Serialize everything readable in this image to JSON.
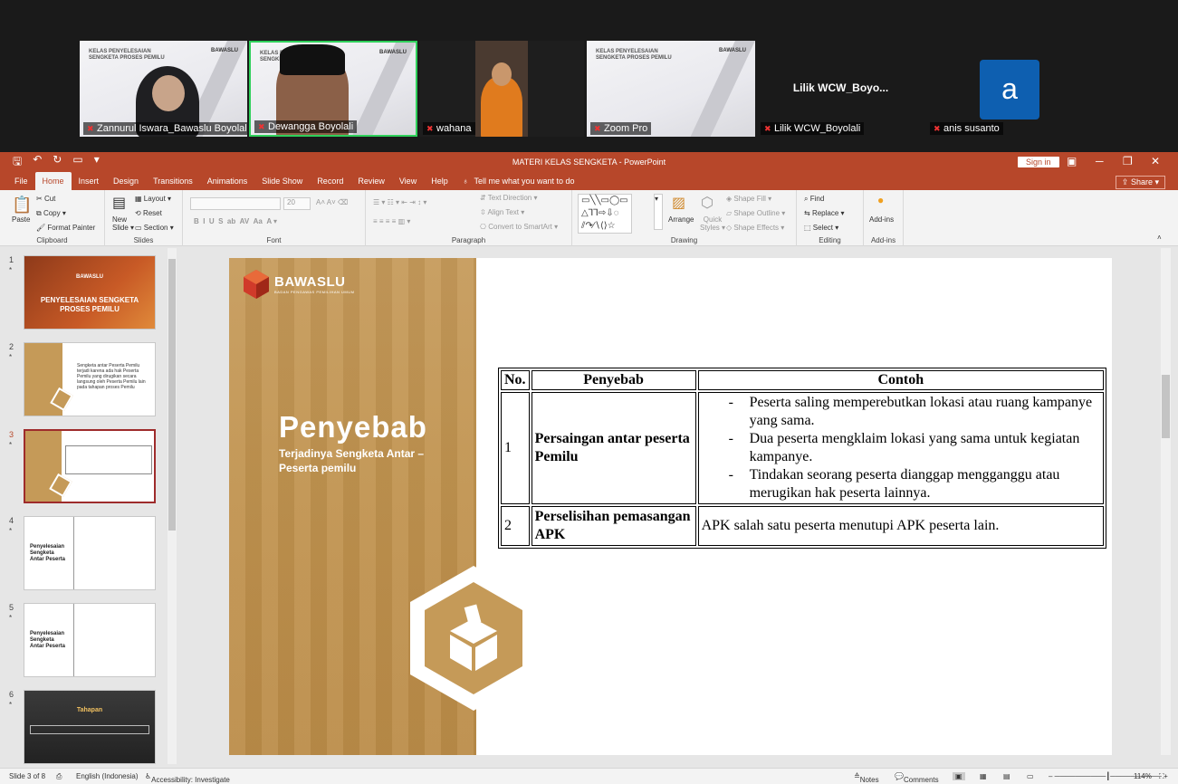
{
  "meeting": {
    "participants": [
      {
        "name": "Zannurul Iswara_Bawaslu Boyolali",
        "type": "video-slide"
      },
      {
        "name": "Dewangga Boyolali",
        "type": "video-slide",
        "active": true
      },
      {
        "name": "wahana",
        "type": "video"
      },
      {
        "name": "Zoom Pro",
        "type": "slide"
      },
      {
        "name": "Lilik WCW_Boyolali",
        "display": "Lilik  WCW_Boyo...",
        "type": "text"
      },
      {
        "name": "anis susanto",
        "initial": "a",
        "type": "avatar"
      }
    ],
    "slide_caption_line1": "KELAS PENYELESAIAN",
    "slide_caption_line2": "SENGKETA PROSES PEMILU",
    "slide_brand": "BAWASLU"
  },
  "app": {
    "title": "MATERI KELAS SENGKETA  -  PowerPoint",
    "signin": "Sign in",
    "share": "Share",
    "tabs": [
      "File",
      "Home",
      "Insert",
      "Design",
      "Transitions",
      "Animations",
      "Slide Show",
      "Record",
      "Review",
      "View",
      "Help"
    ],
    "tell_me": "Tell me what you want to do"
  },
  "ribbon": {
    "clipboard": {
      "label": "Clipboard",
      "paste": "Paste",
      "cut": "Cut",
      "copy": "Copy",
      "format_painter": "Format Painter"
    },
    "slides": {
      "label": "Slides",
      "new_slide": "New",
      "new_slide2": "Slide",
      "layout": "Layout",
      "reset": "Reset",
      "section": "Section"
    },
    "font": {
      "label": "Font",
      "size": "20"
    },
    "paragraph": {
      "label": "Paragraph",
      "text_direction": "Text Direction",
      "align_text": "Align Text",
      "convert": "Convert to SmartArt"
    },
    "drawing": {
      "label": "Drawing",
      "arrange": "Arrange",
      "quick_styles": "Quick",
      "quick_styles2": "Styles",
      "shape_fill": "Shape Fill",
      "shape_outline": "Shape Outline",
      "shape_effects": "Shape Effects"
    },
    "editing": {
      "label": "Editing",
      "find": "Find",
      "replace": "Replace",
      "select": "Select"
    },
    "addins": {
      "label": "Add-ins",
      "addins_btn": "Add-ins"
    }
  },
  "thumbnails": [
    {
      "num": "1",
      "text1": "PENYELESAIAN SENGKETA",
      "text2": "PROSES PEMILU",
      "brand": "BAWASLU"
    },
    {
      "num": "2",
      "text": "Sengketa antar Peserta Pemilu terjadi karena ada hak Peserta Pemilu yang dirugikan secara langsung oleh Peserta Pemilu lain pada tahapan proses Pemilu"
    },
    {
      "num": "3",
      "selected": true
    },
    {
      "num": "4",
      "title": "Penyelesaian Sengketa Antar Peserta"
    },
    {
      "num": "5",
      "title": "Penyelesaian Sengketa Antar Peserta"
    },
    {
      "num": "6",
      "title": "Tahapan"
    }
  ],
  "slide": {
    "brand": "BAWASLU",
    "brand_sub": "BADAN PENGAWAS PEMILIHAN UMUM",
    "title": "Penyebab",
    "subtitle1": "Terjadinya Sengketa Antar –",
    "subtitle2": "Peserta pemilu",
    "table": {
      "headers": [
        "No.",
        "Penyebab",
        "Contoh"
      ],
      "rows": [
        {
          "no": "1",
          "cause": "Persaingan antar peserta Pemilu",
          "examples": [
            "Peserta saling memperebutkan lokasi atau ruang kampanye yang sama.",
            "Dua peserta mengklaim lokasi yang sama untuk kegiatan kampanye.",
            "Tindakan seorang peserta dianggap mengganggu atau merugikan hak peserta lainnya."
          ]
        },
        {
          "no": "2",
          "cause": "Perselisihan pemasangan APK",
          "example": "APK salah satu peserta menutupi APK peserta lain."
        }
      ]
    }
  },
  "status": {
    "slide_of": "Slide 3 of 8",
    "language": "English (Indonesia)",
    "accessibility": "Accessibility: Investigate",
    "notes": "Notes",
    "comments": "Comments",
    "zoom": "114%"
  },
  "colors": {
    "accent": "#b7472a",
    "gold": "#c59a58"
  }
}
